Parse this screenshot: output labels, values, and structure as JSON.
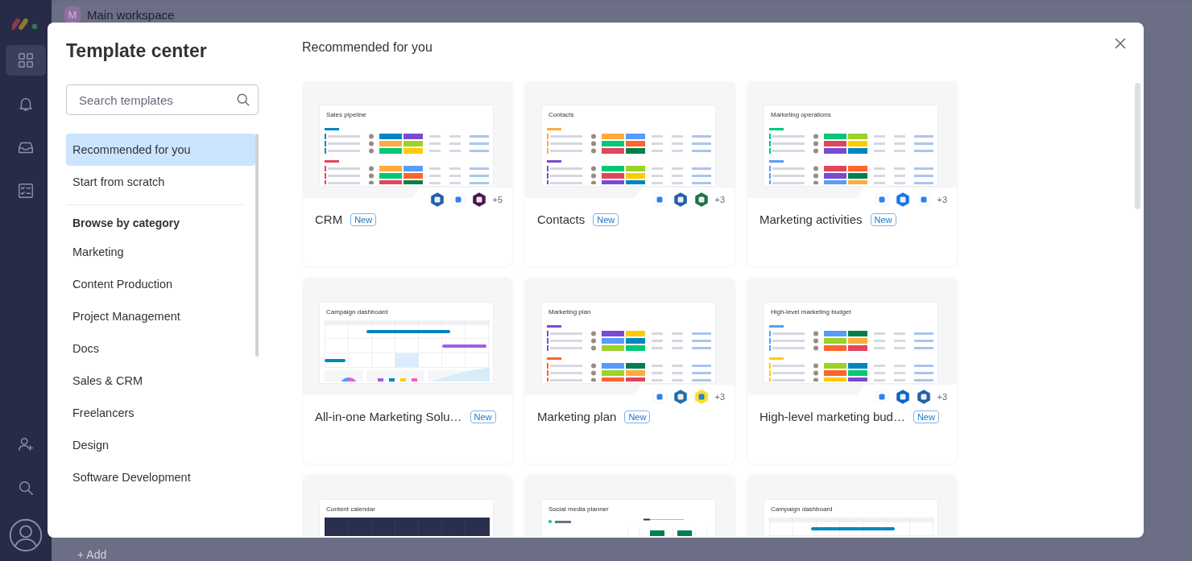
{
  "workspace": {
    "avatar_letter": "M",
    "name": "Main workspace",
    "add_label": "+ Add"
  },
  "sidebar": {
    "items": [
      {
        "kind": "grid",
        "selected": true
      },
      {
        "kind": "bell",
        "selected": false
      },
      {
        "kind": "inbox",
        "selected": false
      },
      {
        "kind": "checklist",
        "selected": false
      },
      {
        "kind": "spacer"
      },
      {
        "kind": "add-user",
        "selected": false
      },
      {
        "kind": "search",
        "selected": false
      },
      {
        "kind": "avatar",
        "selected": false
      }
    ]
  },
  "modal": {
    "title": "Template center",
    "search": {
      "placeholder": "Search templates"
    },
    "nav": [
      {
        "label": "Recommended for you",
        "selected": true
      },
      {
        "label": "Start from scratch",
        "selected": false
      }
    ],
    "category_heading": "Browse by category",
    "categories": [
      {
        "label": "Marketing",
        "selected": false
      },
      {
        "label": "Content Production",
        "selected": false
      },
      {
        "label": "Project Management",
        "selected": false
      },
      {
        "label": "Docs",
        "selected": false
      },
      {
        "label": "Sales & CRM",
        "selected": false
      },
      {
        "label": "Freelancers",
        "selected": false
      },
      {
        "label": "Design",
        "selected": false
      },
      {
        "label": "Software Development",
        "selected": false
      }
    ],
    "heading": "Recommended for you",
    "cards": [
      {
        "title": "CRM",
        "badge": "New",
        "preview": {
          "kind": "table",
          "title": "Sales pipeline"
        },
        "integrations": [
          {
            "color": "#1f5fa6"
          },
          {
            "color": "#ffffff"
          },
          {
            "color": "#4a154b"
          }
        ],
        "more": "+5"
      },
      {
        "title": "Contacts",
        "badge": "New",
        "preview": {
          "kind": "table",
          "title": "Contacts"
        },
        "integrations": [
          {
            "color": "#ffffff"
          },
          {
            "color": "#1f5fa6"
          },
          {
            "color": "#1e7145"
          }
        ],
        "more": "+3"
      },
      {
        "title": "Marketing activities",
        "badge": "New",
        "preview": {
          "kind": "table",
          "title": "Marketing operations"
        },
        "integrations": [
          {
            "color": "#ffffff"
          },
          {
            "color": "#1a73e8"
          },
          {
            "color": "#ffffff"
          }
        ],
        "more": "+3"
      },
      {
        "title": "All-in-one Marketing Solu…",
        "badge": "New",
        "preview": {
          "kind": "dashboard",
          "title": "Campaign dashboard"
        }
      },
      {
        "title": "Marketing plan",
        "badge": "New",
        "preview": {
          "kind": "table",
          "title": "Marketing plan"
        },
        "integrations": [
          {
            "color": "#ffffff"
          },
          {
            "color": "#1e6fa8"
          },
          {
            "color": "#ffe01b"
          }
        ],
        "more": "+3"
      },
      {
        "title": "High-level marketing bud…",
        "badge": "New",
        "preview": {
          "kind": "table",
          "title": "High-level marketing budget"
        },
        "integrations": [
          {
            "color": "#ffffff"
          },
          {
            "color": "#0a66c2"
          },
          {
            "color": "#1f5fa6"
          }
        ],
        "more": "+3"
      },
      {
        "preview": {
          "kind": "calendar",
          "title": "Content calendar"
        }
      },
      {
        "preview": {
          "kind": "timeline",
          "title": "Social media planner"
        }
      },
      {
        "preview": {
          "kind": "dashboard",
          "title": "Campaign dashboard"
        }
      }
    ]
  }
}
